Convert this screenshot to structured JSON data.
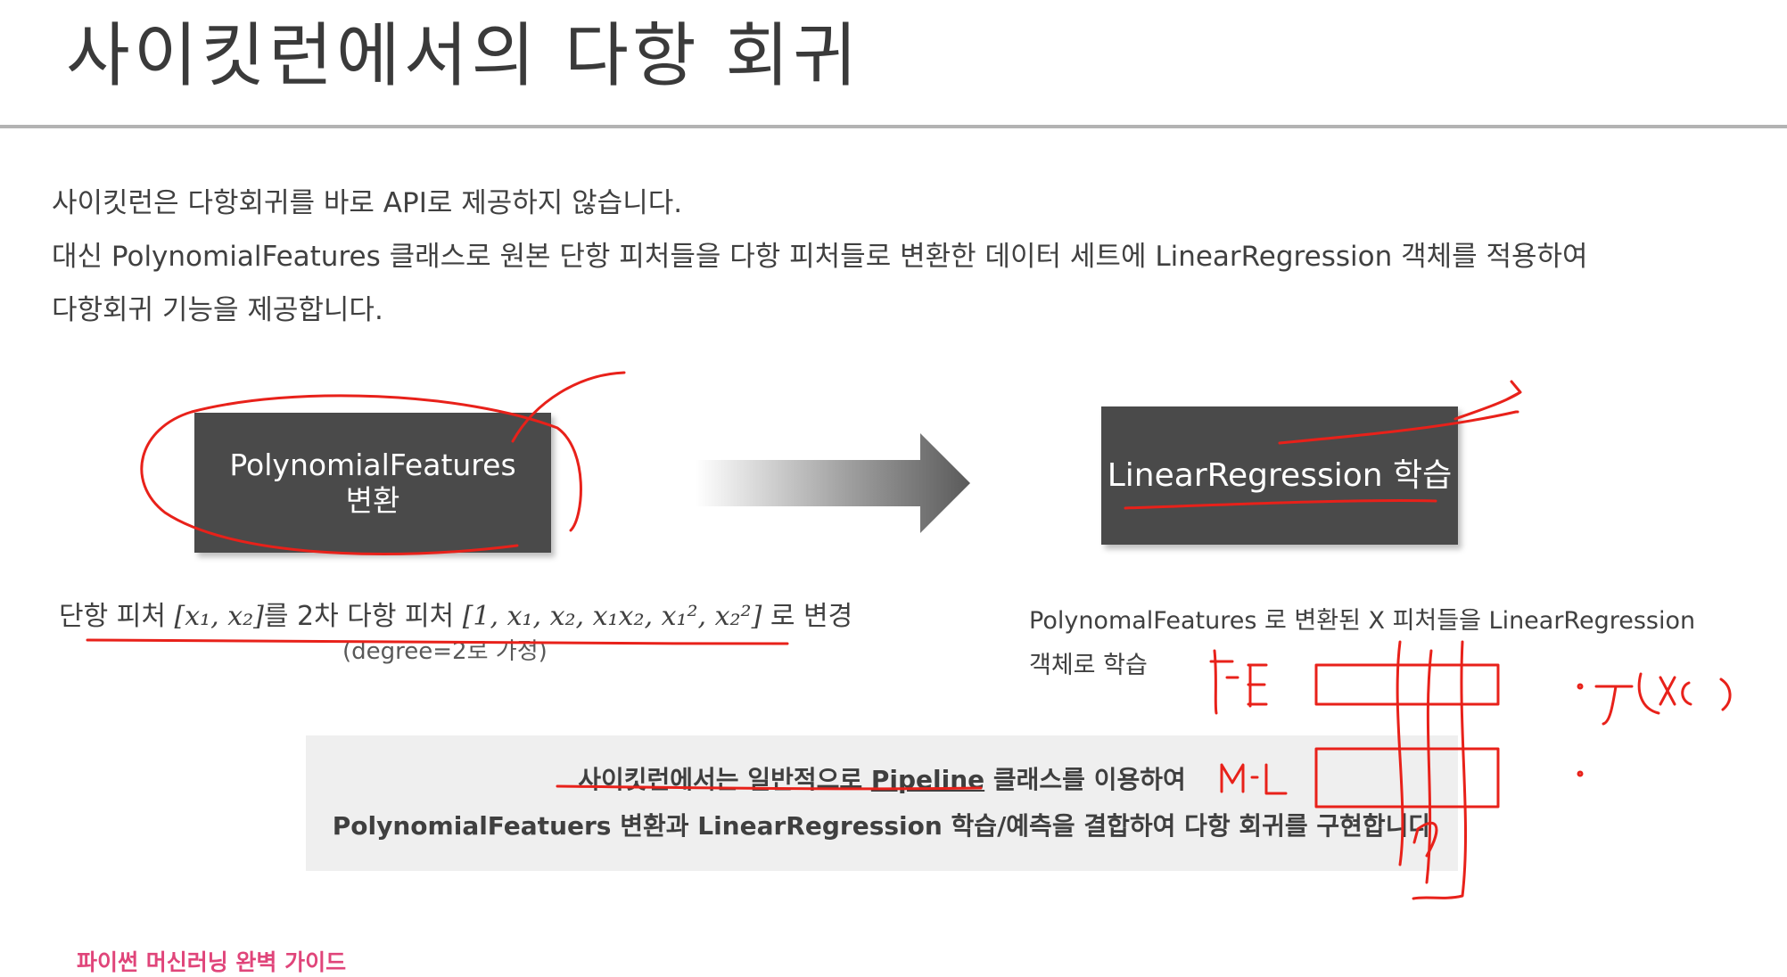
{
  "title": "사이킷런에서의 다항 회귀",
  "intro": {
    "line1": "사이킷런은 다항회귀를 바로 API로 제공하지 않습니다.",
    "line2": "대신 PolynomialFeatures 클래스로 원본 단항 피처들을 다항 피처들로 변환한 데이터 세트에 LinearRegression 객체를 적용하여",
    "line3": "다항회귀 기능을 제공합니다."
  },
  "box_left": {
    "line1": "PolynomialFeatures",
    "line2": "변환"
  },
  "box_right": {
    "label": "LinearRegression 학습"
  },
  "caption_left": {
    "prefix": "단항 피처 ",
    "x_single": "[x₁, x₂]",
    "middle": "를 2차 다항 피처 ",
    "x_poly": "[1, x₁, x₂, x₁x₂, x₁², x₂²]",
    "suffix": " 로 변경",
    "sub": "(degree=2로 가정)"
  },
  "caption_right": {
    "line1": "PolynomalFeatures 로 변환된 X 피처들을 LinearRegression",
    "line2": "객체로 학습"
  },
  "note": {
    "line1_pre": "사이킷런에서는 일반적으로 ",
    "line1_link": "Pipeline",
    "line1_post": " 클래스를 이용하여",
    "line2": "PolynomialFeatuers 변환과 LinearRegression 학습/예측을 결합하여 다항 회귀를 구현합니다"
  },
  "footer": "파이썬 머신러닝 완벽 가이드",
  "handwriting": {
    "fe": "f.E",
    "ml": "M.L",
    "fx": "·f(x(  )"
  },
  "colors": {
    "box_bg": "#4a4a4a",
    "ink": "#e8211a",
    "footer": "#e0457a",
    "note_bg": "#efefef"
  }
}
